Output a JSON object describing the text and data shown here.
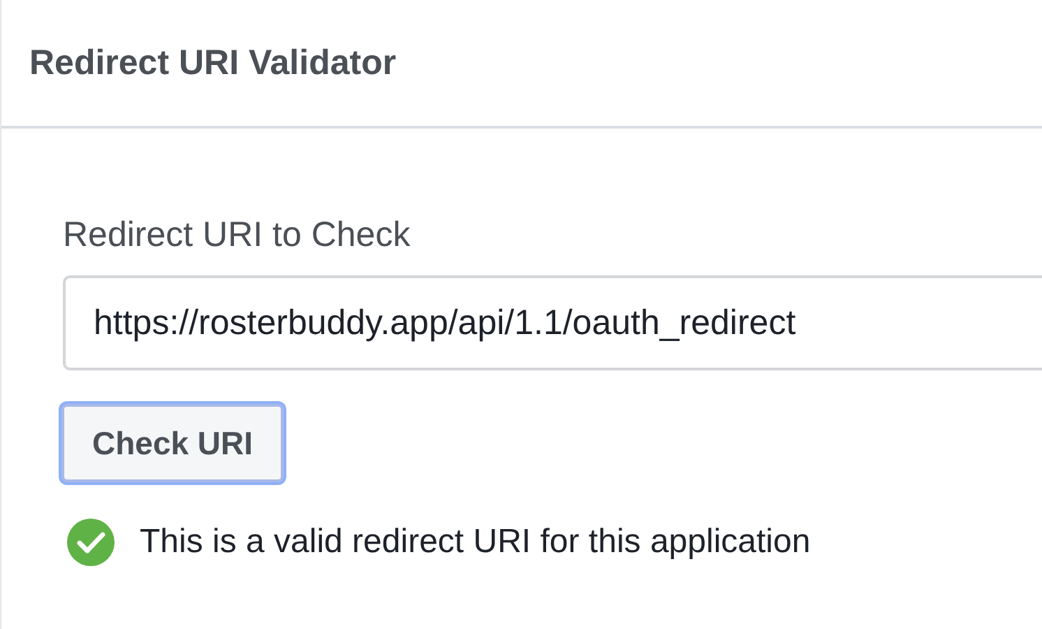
{
  "header": {
    "title": "Redirect URI Validator"
  },
  "form": {
    "label": "Redirect URI to Check",
    "value": "https://rosterbuddy.app/api/1.1/oauth_redirect",
    "button": {
      "label": "Check URI",
      "focused": true
    },
    "result": {
      "kind": "valid",
      "message": "This is a valid redirect URI for this application"
    }
  }
}
